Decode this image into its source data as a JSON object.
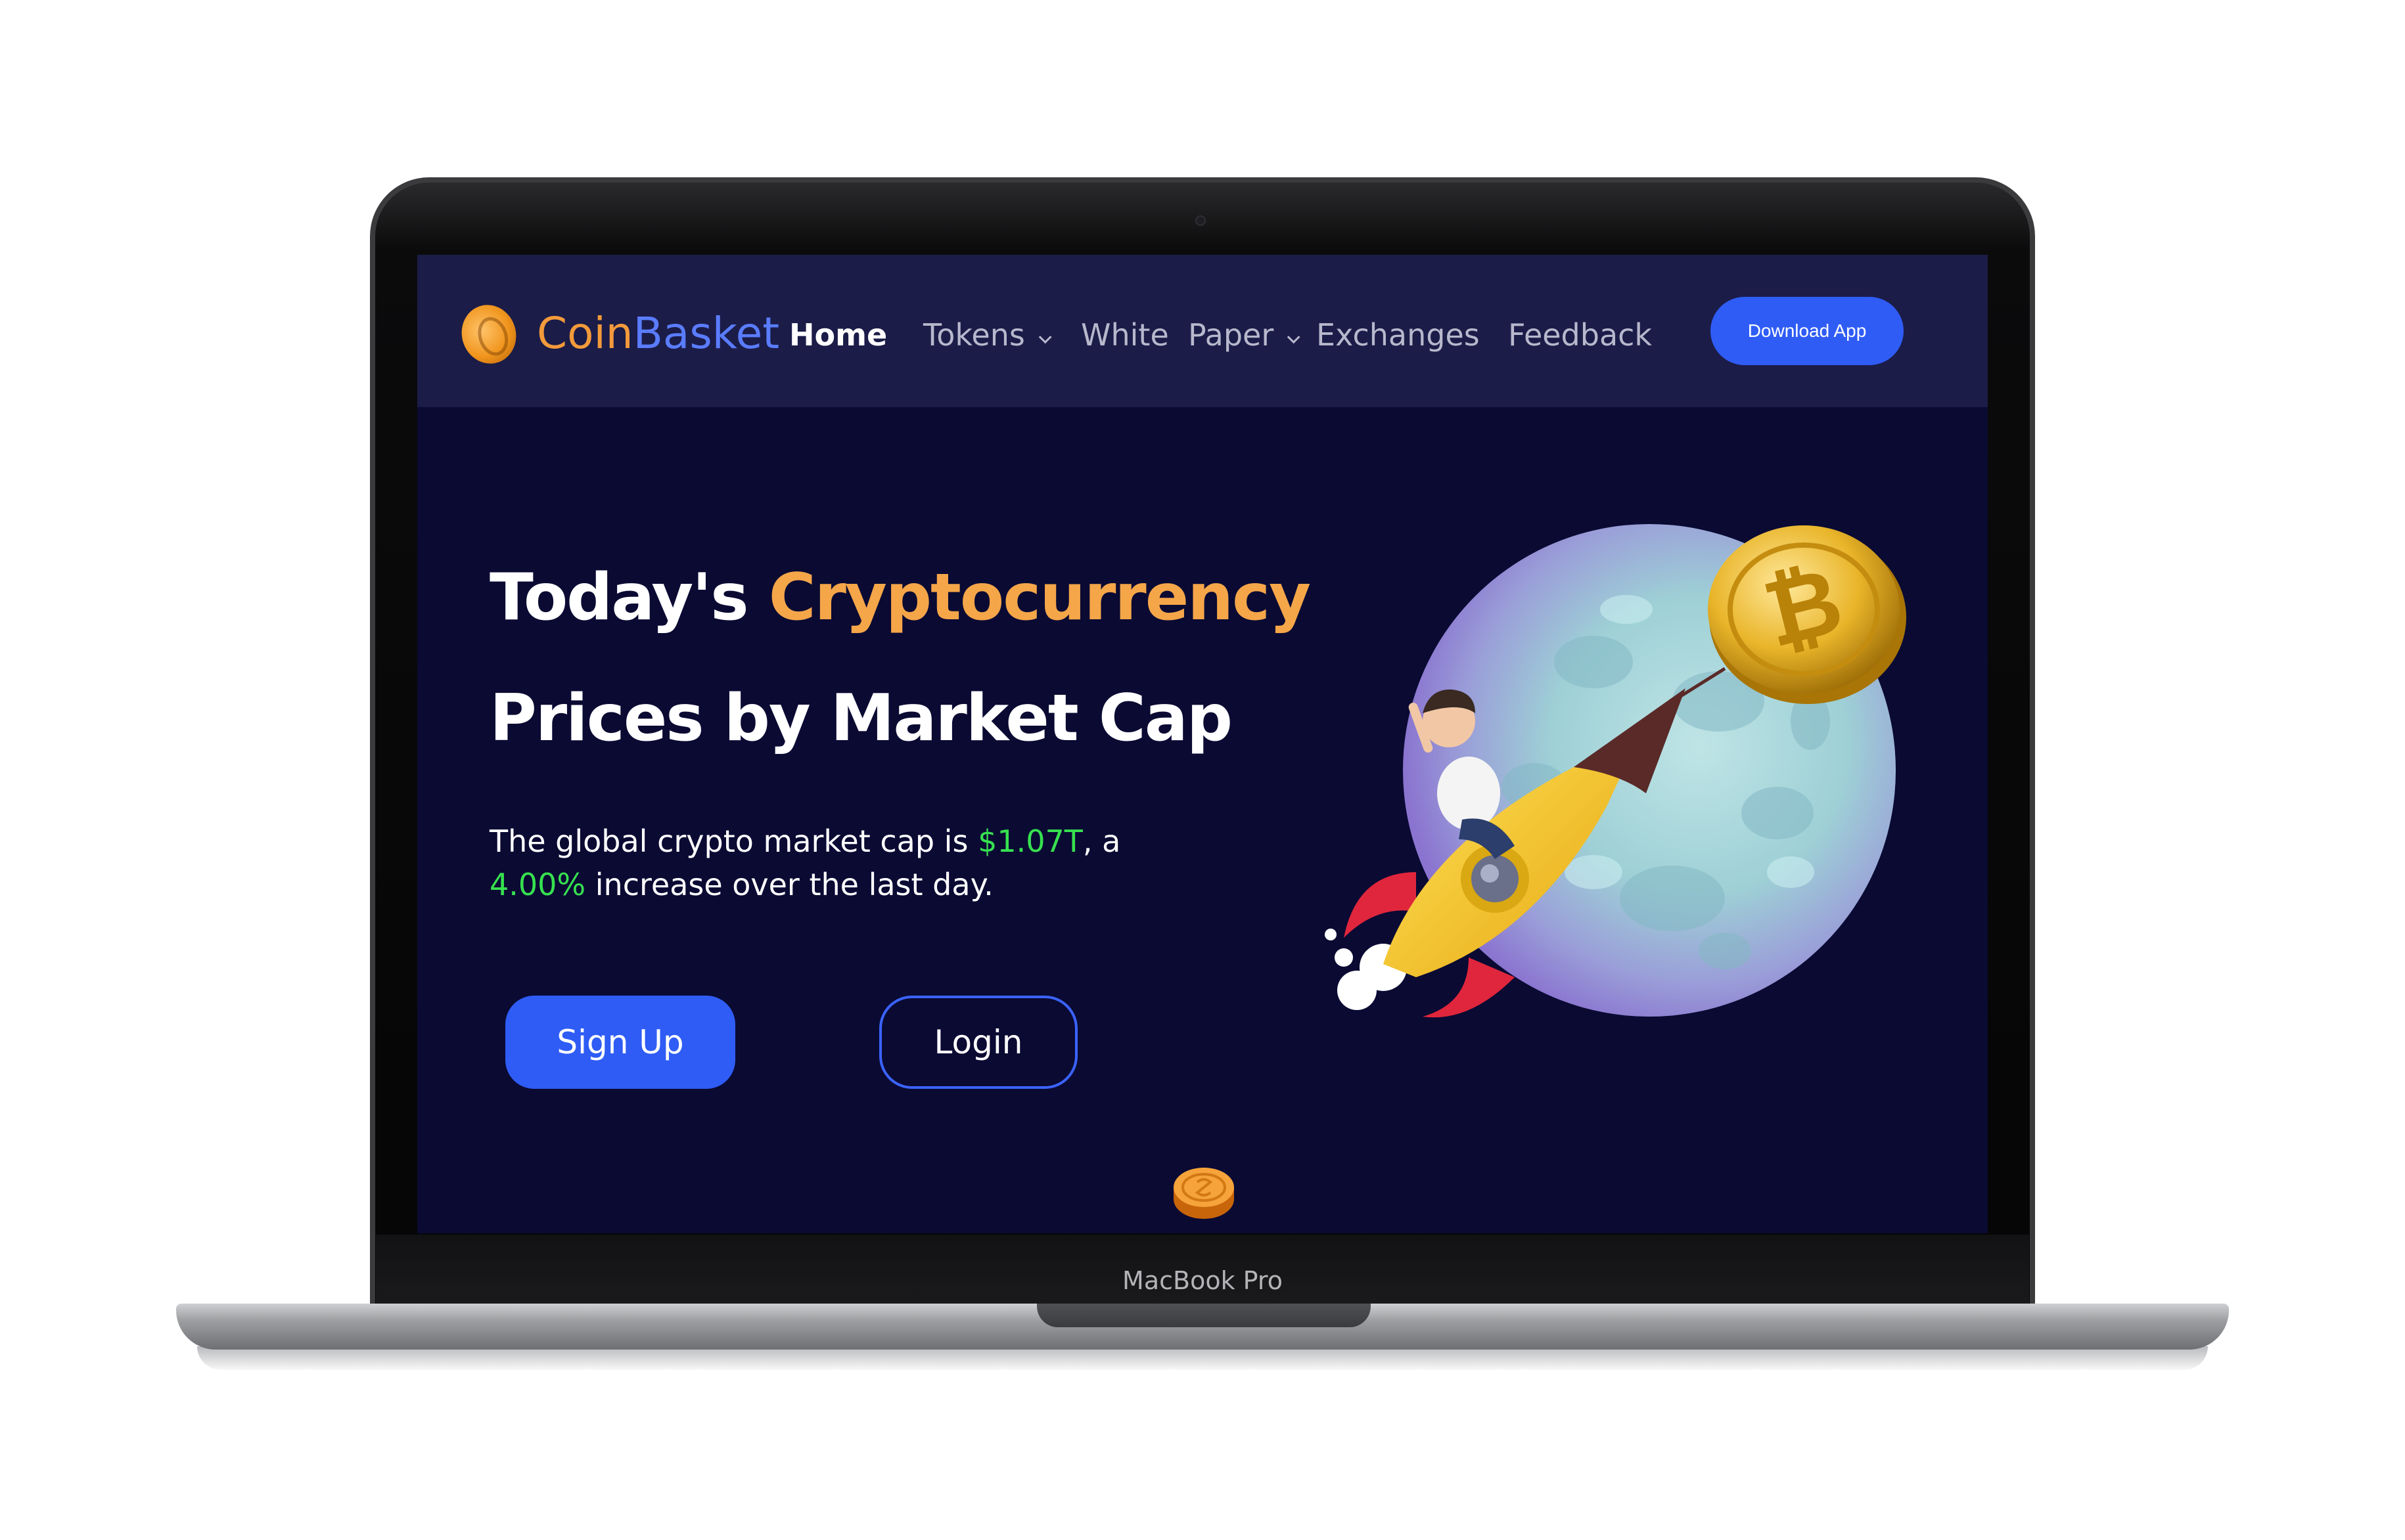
{
  "device": {
    "label": "MacBook Pro"
  },
  "navbar": {
    "brand_part1": "Coin",
    "brand_part2": "Basket",
    "items": [
      {
        "label": "Home",
        "active": true
      },
      {
        "label": "Tokens",
        "has_dropdown": true
      },
      {
        "label": "White  Paper",
        "has_dropdown": true
      },
      {
        "label": "Exchanges"
      },
      {
        "label": "Feedback"
      }
    ],
    "download_label": "Download App"
  },
  "hero": {
    "title_part1": "Today's ",
    "title_highlight": "Cryptocurrency",
    "title_part2": " Prices by Market Cap",
    "desc_part1": "The global crypto market cap is ",
    "market_cap": "$1.07T",
    "desc_part2": ", a ",
    "change_pct": "4.00%",
    "desc_part3": " increase over the last day.",
    "signup_label": "Sign Up",
    "login_label": "Login"
  },
  "icons": {
    "logo": "coin-logo-icon",
    "chevron": "chevron-down-icon",
    "scroll": "coin-scroll-icon",
    "illustration": "rocket-moon-bitcoin-illustration"
  },
  "colors": {
    "background": "#0a0a33",
    "navbar": "#1b1c48",
    "accent_blue": "#2f5cf5",
    "highlight_orange": "#f5a649",
    "positive_green": "#37e14f"
  }
}
